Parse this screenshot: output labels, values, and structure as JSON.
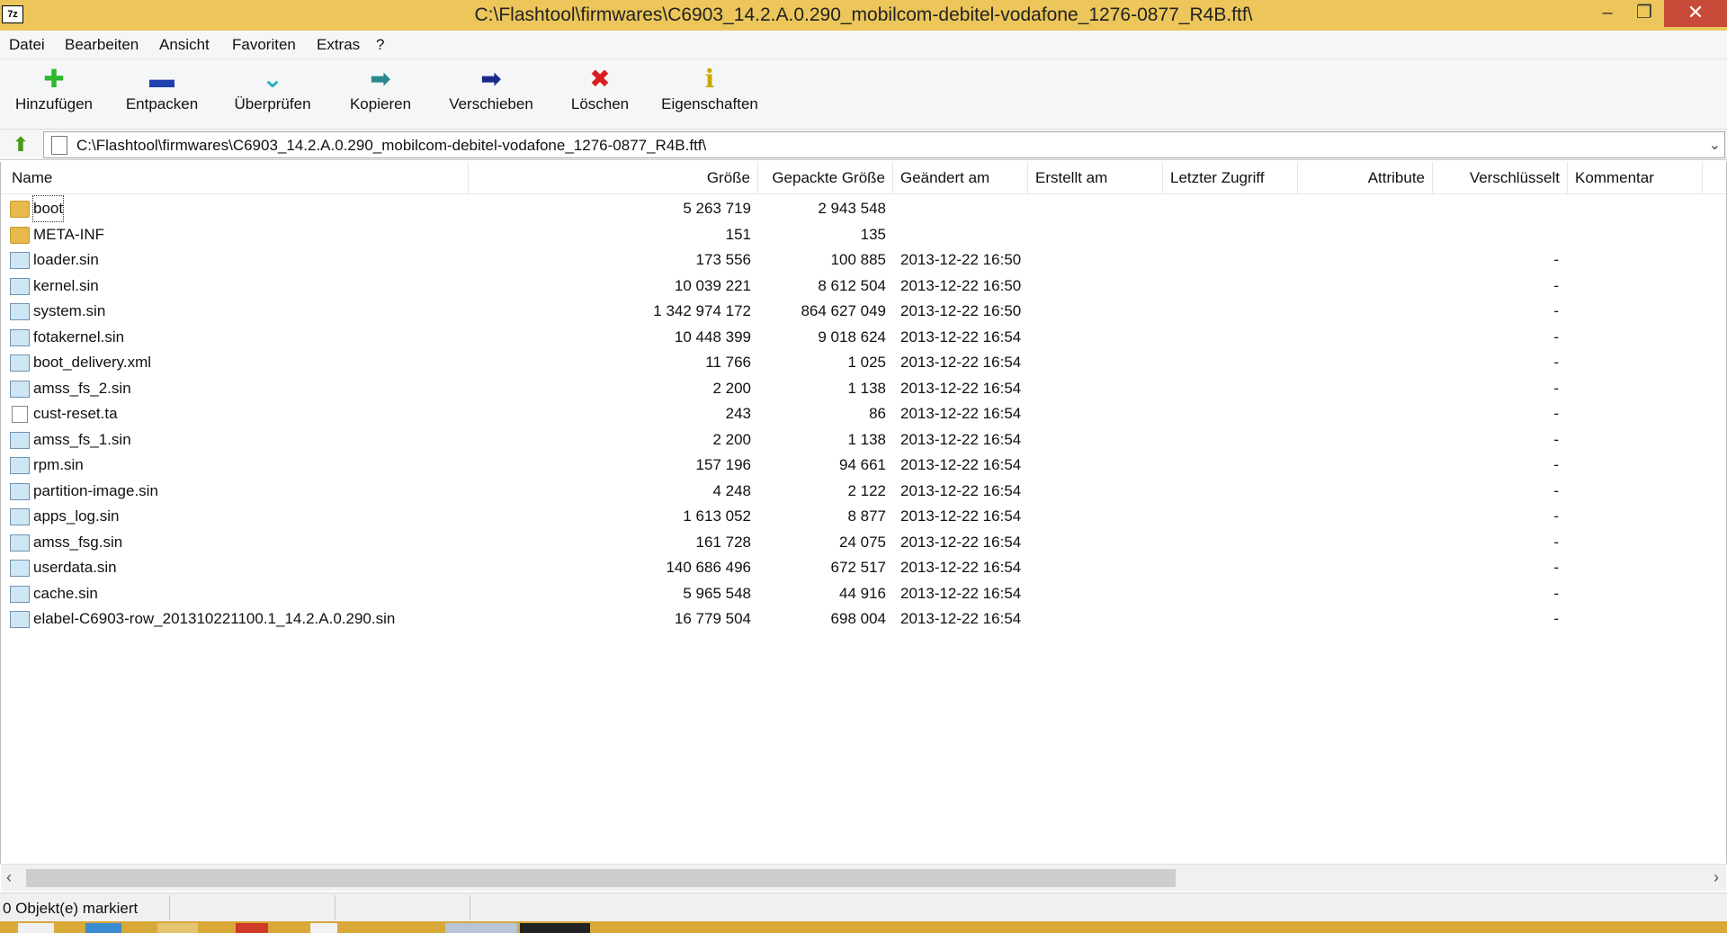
{
  "window": {
    "app_icon_text": "7z",
    "title": "C:\\Flashtool\\firmwares\\C6903_14.2.A.0.290_mobilcom-debitel-vodafone_1276-0877_R4B.ftf\\",
    "minimize": "–",
    "maximize": "❐",
    "close": "✕"
  },
  "menu": [
    "Datei",
    "Bearbeiten",
    "Ansicht",
    "Favoriten",
    "Extras",
    "?"
  ],
  "toolbar": [
    {
      "label": "Hinzufügen",
      "icon": "add-icon",
      "glyph": "✚",
      "color": "#2db82d"
    },
    {
      "label": "Entpacken",
      "icon": "extract-icon",
      "glyph": "▬",
      "color": "#1f3fb0"
    },
    {
      "label": "Überprüfen",
      "icon": "test-icon",
      "glyph": "⌄",
      "color": "#2bb0b8"
    },
    {
      "label": "Kopieren",
      "icon": "copy-icon",
      "glyph": "➡",
      "color": "#2a8a8a"
    },
    {
      "label": "Verschieben",
      "icon": "move-icon",
      "glyph": "➡",
      "color": "#1a2a8c"
    },
    {
      "label": "Löschen",
      "icon": "delete-icon",
      "glyph": "✖",
      "color": "#d81e1e"
    },
    {
      "label": "Eigenschaften",
      "icon": "info-icon",
      "glyph": "ℹ",
      "color": "#c9a800"
    }
  ],
  "address": {
    "path": "C:\\Flashtool\\firmwares\\C6903_14.2.A.0.290_mobilcom-debitel-vodafone_1276-0877_R4B.ftf\\"
  },
  "columns": [
    "Name",
    "Größe",
    "Gepackte Größe",
    "Geändert am",
    "Erstellt am",
    "Letzter Zugriff",
    "Attribute",
    "Verschlüsselt",
    "Kommentar"
  ],
  "files": [
    {
      "name": "boot",
      "type": "folder",
      "size": "5 263 719",
      "packed": "2 943 548",
      "modified": "",
      "encrypted": ""
    },
    {
      "name": "META-INF",
      "type": "folder",
      "size": "151",
      "packed": "135",
      "modified": "",
      "encrypted": ""
    },
    {
      "name": "loader.sin",
      "type": "file",
      "size": "173 556",
      "packed": "100 885",
      "modified": "2013-12-22 16:50",
      "encrypted": "-"
    },
    {
      "name": "kernel.sin",
      "type": "file",
      "size": "10 039 221",
      "packed": "8 612 504",
      "modified": "2013-12-22 16:50",
      "encrypted": "-"
    },
    {
      "name": "system.sin",
      "type": "file",
      "size": "1 342 974 172",
      "packed": "864 627 049",
      "modified": "2013-12-22 16:50",
      "encrypted": "-"
    },
    {
      "name": "fotakernel.sin",
      "type": "file",
      "size": "10 448 399",
      "packed": "9 018 624",
      "modified": "2013-12-22 16:54",
      "encrypted": "-"
    },
    {
      "name": "boot_delivery.xml",
      "type": "file",
      "size": "11 766",
      "packed": "1 025",
      "modified": "2013-12-22 16:54",
      "encrypted": "-"
    },
    {
      "name": "amss_fs_2.sin",
      "type": "file",
      "size": "2 200",
      "packed": "1 138",
      "modified": "2013-12-22 16:54",
      "encrypted": "-"
    },
    {
      "name": "cust-reset.ta",
      "type": "blank",
      "size": "243",
      "packed": "86",
      "modified": "2013-12-22 16:54",
      "encrypted": "-"
    },
    {
      "name": "amss_fs_1.sin",
      "type": "file",
      "size": "2 200",
      "packed": "1 138",
      "modified": "2013-12-22 16:54",
      "encrypted": "-"
    },
    {
      "name": "rpm.sin",
      "type": "file",
      "size": "157 196",
      "packed": "94 661",
      "modified": "2013-12-22 16:54",
      "encrypted": "-"
    },
    {
      "name": "partition-image.sin",
      "type": "file",
      "size": "4 248",
      "packed": "2 122",
      "modified": "2013-12-22 16:54",
      "encrypted": "-"
    },
    {
      "name": "apps_log.sin",
      "type": "file",
      "size": "1 613 052",
      "packed": "8 877",
      "modified": "2013-12-22 16:54",
      "encrypted": "-"
    },
    {
      "name": "amss_fsg.sin",
      "type": "file",
      "size": "161 728",
      "packed": "24 075",
      "modified": "2013-12-22 16:54",
      "encrypted": "-"
    },
    {
      "name": "userdata.sin",
      "type": "file",
      "size": "140 686 496",
      "packed": "672 517",
      "modified": "2013-12-22 16:54",
      "encrypted": "-"
    },
    {
      "name": "cache.sin",
      "type": "file",
      "size": "5 965 548",
      "packed": "44 916",
      "modified": "2013-12-22 16:54",
      "encrypted": "-"
    },
    {
      "name": "elabel-C6903-row_201310221100.1_14.2.A.0.290.sin",
      "type": "file",
      "size": "16 779 504",
      "packed": "698 004",
      "modified": "2013-12-22 16:54",
      "encrypted": "-"
    }
  ],
  "scrollbar": {
    "left": "‹",
    "right": "›"
  },
  "status": {
    "text": "0 Objekt(e) markiert"
  },
  "colors": {
    "titlebar": "#ecc65a",
    "close": "#c74b38",
    "taskbar": "#d8a838"
  }
}
